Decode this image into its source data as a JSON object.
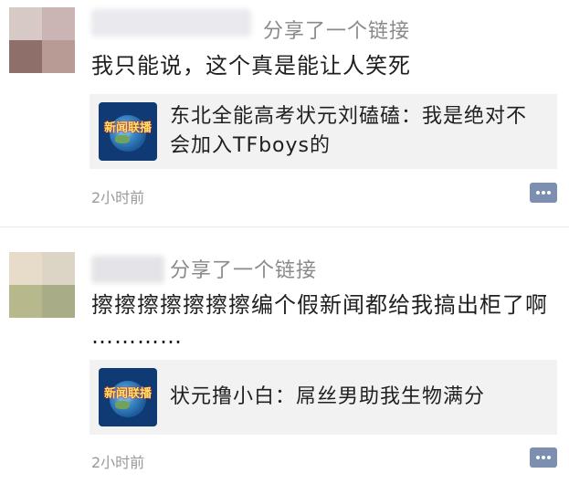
{
  "posts": [
    {
      "share_label": "分享了一个链接",
      "text_line1": "我只能说，这个真是能让人笑死",
      "text_line2": "",
      "link_title_line1": "东北全能高考状元刘磕磕：我是绝对不",
      "link_title_line2": "会加入TFboys的",
      "thumbnail_logo": "新闻联播",
      "time": "2小时前",
      "comment_icon": "comment-icon"
    },
    {
      "share_label": "分享了一个链接",
      "text_line1": "擦擦擦擦擦擦擦编个假新闻都给我搞出柜了啊",
      "text_line2": "…………",
      "link_title_line1": "状元撸小白：屌丝男助我生物满分",
      "link_title_line2": "",
      "thumbnail_logo": "新闻联播",
      "time": "2小时前",
      "comment_icon": "comment-icon"
    }
  ],
  "colors": {
    "link_card_bg": "#f2f2f2",
    "comment_button": "#7d8fb0",
    "meta_text": "#9a9a9a"
  }
}
